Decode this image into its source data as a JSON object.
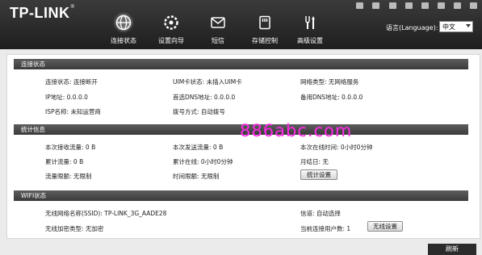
{
  "header": {
    "logo": "TP-LINK",
    "nav": [
      {
        "label": "连接状态",
        "icon": "globe-icon"
      },
      {
        "label": "设置向导",
        "icon": "wizard-icon"
      },
      {
        "label": "短信",
        "icon": "message-icon"
      },
      {
        "label": "存储控制",
        "icon": "storage-icon"
      },
      {
        "label": "高级设置",
        "icon": "tools-icon"
      }
    ],
    "language_label": "语言(Language):",
    "language_value": "中文"
  },
  "sections": {
    "connection": {
      "title": "连接状态",
      "conn_status": "连接状态: 连接断开",
      "uim_status": "UIM卡状态: 未插入UIM卡",
      "net_type": "网络类型: 无网络服务",
      "ip": "IP地址: 0.0.0.0",
      "dns1": "首选DNS地址: 0.0.0.0",
      "dns2": "备用DNS地址: 0.0.0.0",
      "isp": "ISP名称: 未知运营商",
      "dial": "拨号方式: 自动拨号"
    },
    "stats": {
      "title": "统计信息",
      "rx": "本次接收流量: 0 B",
      "tx": "本次发送流量: 0 B",
      "online_time": "本次在线时间: 0小时0分钟",
      "total_flow": "累计流量: 0 B",
      "total_online": "累计在线: 0小时0分钟",
      "settle_day": "月结日: 无",
      "flow_limit": "流量限额: 无限制",
      "time_limit": "时间限额: 无限制",
      "settings_btn": "统计设置"
    },
    "wifi": {
      "title": "WIFI状态",
      "ssid": "无线网络名称(SSID): TP-LINK_3G_AADE28",
      "channel": "信道: 自动选择",
      "encryption": "无线加密类型: 无加密",
      "users": "当前连接用户数: 1",
      "settings_btn": "无线设置"
    }
  },
  "watermark": "886abc.com",
  "refresh_btn": "刷新",
  "colors": {
    "header_bg": "#2a2a2a",
    "section_bar": "#4a4a4a",
    "watermark": "#ff2ae8"
  }
}
